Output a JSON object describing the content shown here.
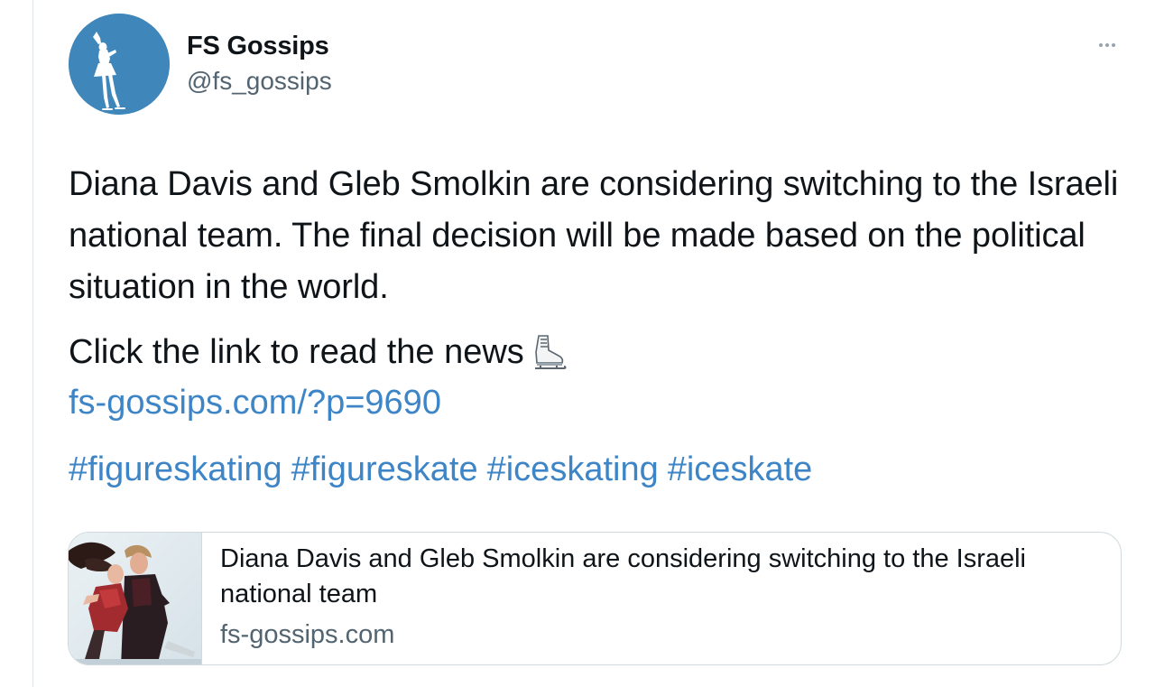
{
  "author": {
    "display_name": "FS Gossips",
    "handle": "@fs_gossips"
  },
  "tweet": {
    "text": "Diana Davis and Gleb Smolkin are considering switching to the Israeli national team. The final decision will be made based on the political situation in the world.",
    "cta": "Click the link to read the news",
    "cta_icon": "ice-skate-icon",
    "link": "fs-gossips.com/?p=9690",
    "hashtags": [
      "#figureskating",
      "#figureskate",
      "#iceskating",
      "#iceskate"
    ]
  },
  "card": {
    "title": "Diana Davis and Gleb Smolkin are considering switching to the Israeli national team",
    "domain": "fs-gossips.com"
  },
  "colors": {
    "link": "#3d85c6",
    "avatar_bg": "#3f86bb",
    "text": "#0f1419",
    "secondary": "#536471",
    "border": "#cfd9de"
  },
  "icons": {
    "more": "more-horizontal-icon",
    "avatar": "figure-skater-logo"
  }
}
